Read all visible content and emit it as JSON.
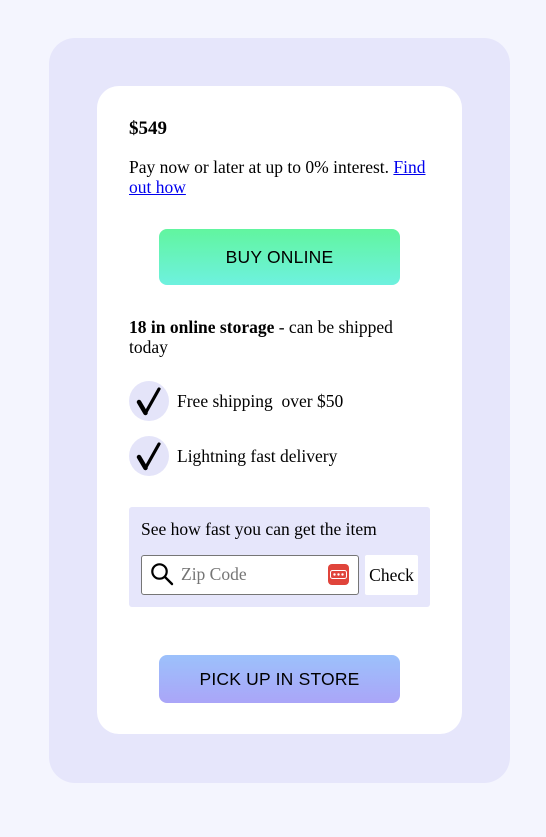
{
  "product": {
    "price": "$549",
    "financing_text": "Pay now or later at up to 0% interest.",
    "financing_link": "Find out how"
  },
  "actions": {
    "buy_online_label": "BUY ONLINE",
    "pick_up_label": "PICK UP IN STORE"
  },
  "stock": {
    "count_text": "18 in online storage",
    "shipping_note": " - can be shipped today"
  },
  "features": [
    {
      "icon": "checkmark-icon",
      "label": "Free shipping  over $50"
    },
    {
      "icon": "checkmark-icon",
      "label": "Lightning fast delivery"
    }
  ],
  "delivery_check": {
    "title": "See how fast you can get the item",
    "zip_placeholder": "Zip Code",
    "zip_value": "",
    "check_label": "Check"
  },
  "colors": {
    "page_bg": "#f4f5fe",
    "panel_bg": "#e6e6fb",
    "buy_gradient_top": "#61f59f",
    "buy_gradient_bottom": "#6ef1df",
    "pickup_gradient_top": "#9cc1fb",
    "pickup_gradient_bottom": "#aaa5f8",
    "link": "#0000ee",
    "password_manager_icon": "#e0443b"
  }
}
